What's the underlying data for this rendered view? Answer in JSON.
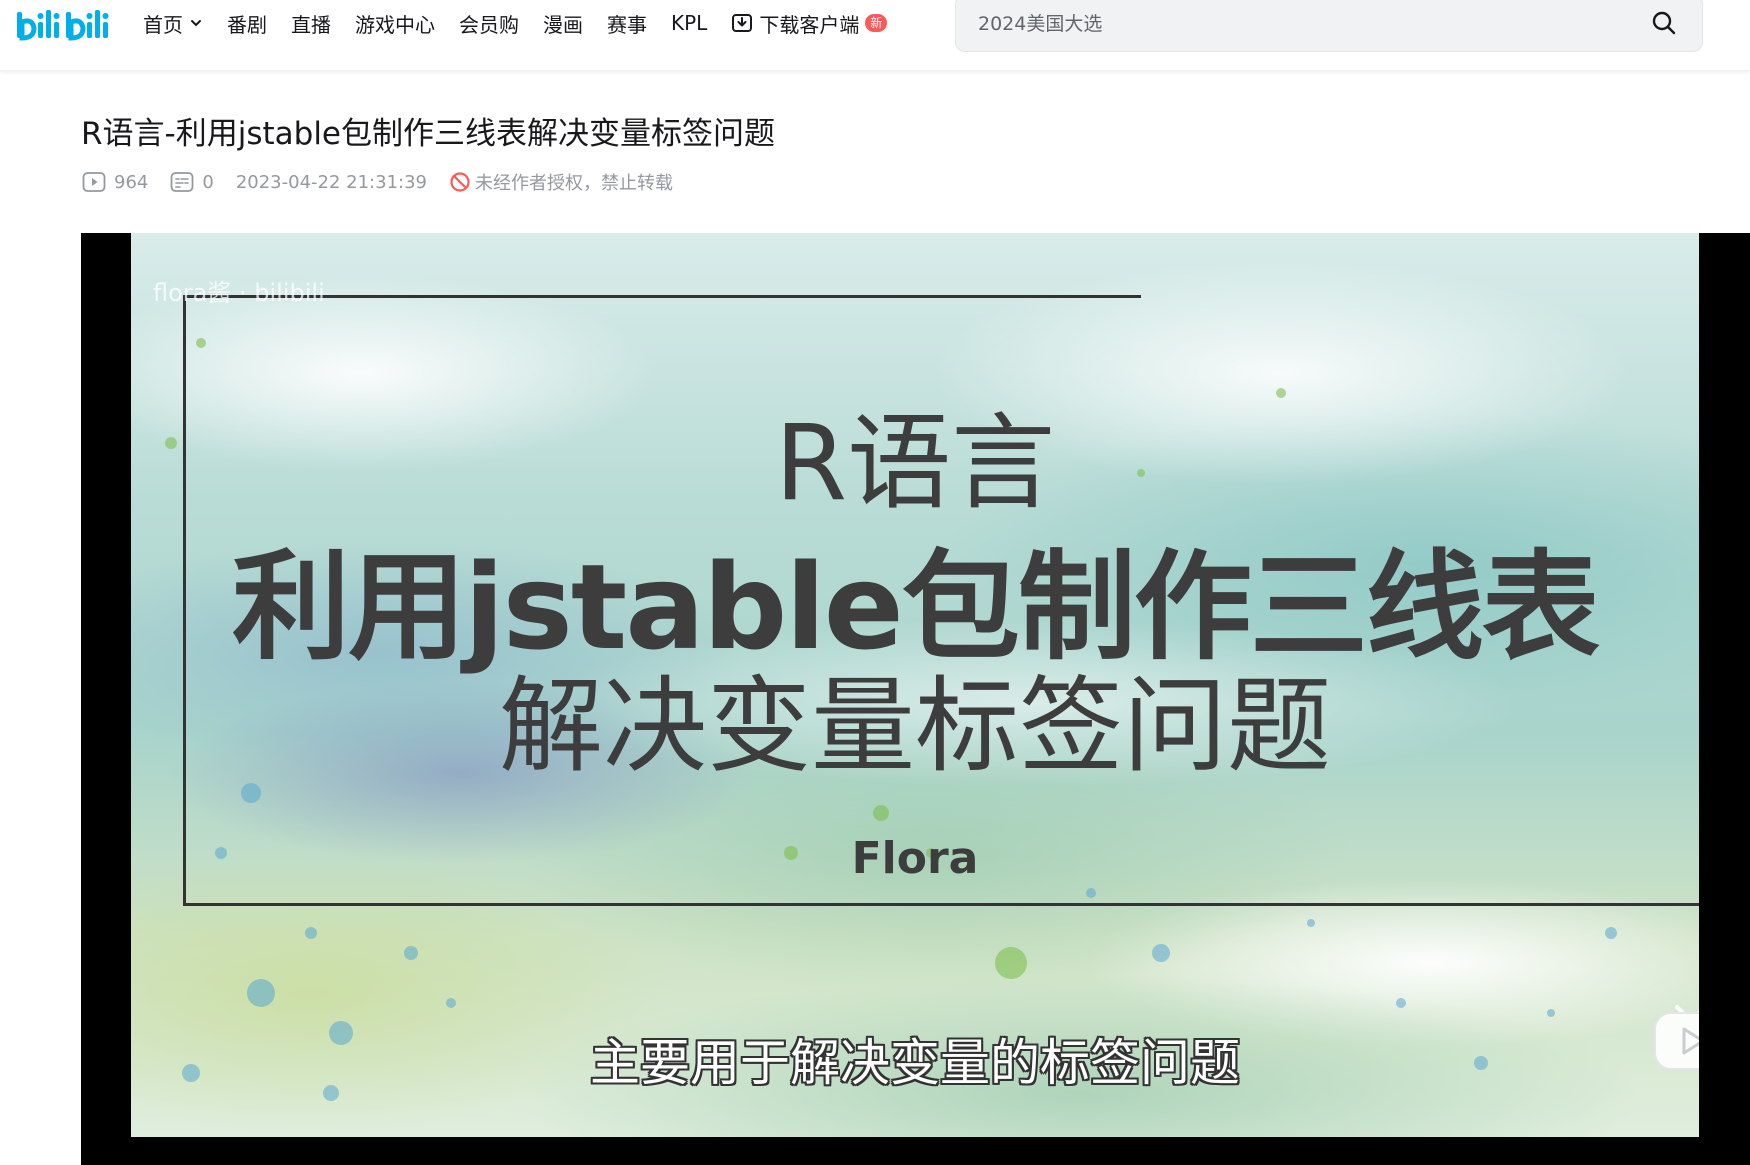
{
  "header": {
    "logo_text": "bilibili",
    "nav": [
      {
        "label": "首页",
        "has_dropdown": true
      },
      {
        "label": "番剧"
      },
      {
        "label": "直播"
      },
      {
        "label": "游戏中心"
      },
      {
        "label": "会员购"
      },
      {
        "label": "漫画"
      },
      {
        "label": "赛事"
      },
      {
        "label": "KPL"
      }
    ],
    "download": {
      "label": "下载客户端",
      "badge": "新",
      "icon": "download-icon"
    },
    "search": {
      "placeholder": "2024美国大选",
      "icon": "search-icon"
    }
  },
  "video": {
    "title": "R语言-利用jstable包制作三线表解决变量标签问题",
    "views": "964",
    "danmaku": "0",
    "datetime": "2023-04-22 21:31:39",
    "copyright_notice": "未经作者授权，禁止转载"
  },
  "player": {
    "watermark": "flora酱 · bilibili",
    "frame_text": {
      "line1": "R语言",
      "line2": "利用jstable包制作三线表",
      "line3": "解决变量标签问题",
      "author": "Flora"
    },
    "subtitle": "主要用于解决变量的标签问题"
  },
  "colors": {
    "brand": "#00aeec",
    "badge": "#fa5a57",
    "meta_text": "#9499a0",
    "forbidden": "#f85a54"
  }
}
